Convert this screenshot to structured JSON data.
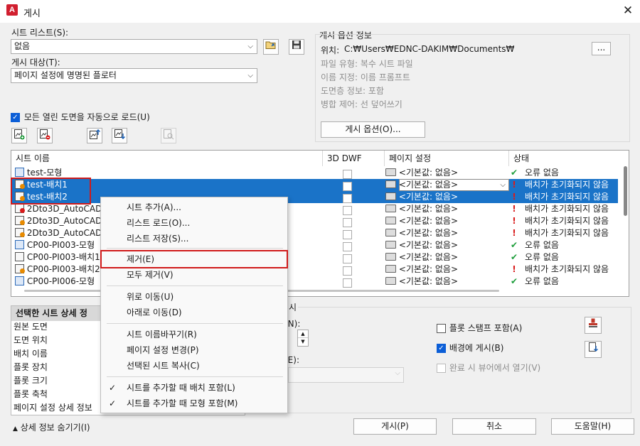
{
  "window": {
    "title": "게시",
    "app_icon_letter": "A"
  },
  "sheet_list": {
    "label": "시트 리스트(S):",
    "value": "없음"
  },
  "publish_to": {
    "label": "게시 대상(T):",
    "value": "페이지 설정에 명명된 플로터"
  },
  "publish_options": {
    "title": "게시 옵션 정보",
    "location_label": "위치:",
    "location_value": "C:₩Users₩EDNC-DAKIM₩Documents₩",
    "browse_label": "...",
    "lines": [
      "파일 유형: 복수 시트 파일",
      "이름 지정: 이름 프롬프트",
      "도면층 정보: 포함",
      "병합 제어: 선 덮어쓰기"
    ],
    "button": "게시 옵션(O)..."
  },
  "auto_load": {
    "label": "모든 열린 도면을 자동으로 로드(U)",
    "checked": true
  },
  "list": {
    "headers": [
      "시트 이름",
      "3D DWF",
      "페이지 설정",
      "상태"
    ],
    "rows": [
      {
        "name": "test-모형",
        "type": "model",
        "page": "<기본값: 없음>",
        "status": "오류 없음",
        "ok": true,
        "selected": false
      },
      {
        "name": "test-배치1",
        "type": "layout-q",
        "page": "<기본값: 없음>",
        "status": "배치가 초기화되지 않음",
        "ok": false,
        "selected": true
      },
      {
        "name": "test-배치2",
        "type": "layout-q",
        "page": "<기본값: 없음>",
        "status": "배치가 초기화되지 않음",
        "ok": false,
        "selected": true
      },
      {
        "name": "2Dto3D_AutoCAD-",
        "type": "layout-stop",
        "page": "<기본값: 없음>",
        "status": "배치가 초기화되지 않음",
        "ok": false,
        "selected": false
      },
      {
        "name": "2Dto3D_AutoCAD-",
        "type": "layout-q",
        "page": "<기본값: 없음>",
        "status": "배치가 초기화되지 않음",
        "ok": false,
        "selected": false
      },
      {
        "name": "2Dto3D_AutoCAD-",
        "type": "layout-q",
        "page": "<기본값: 없음>",
        "status": "배치가 초기화되지 않음",
        "ok": false,
        "selected": false
      },
      {
        "name": "CP00-PI003-모형",
        "type": "model",
        "page": "<기본값: 없음>",
        "status": "오류 없음",
        "ok": true,
        "selected": false
      },
      {
        "name": "CP00-PI003-배치1",
        "type": "layout",
        "page": "<기본값: 없음>",
        "status": "오류 없음",
        "ok": true,
        "selected": false
      },
      {
        "name": "CP00-PI003-배치2",
        "type": "layout-q",
        "page": "<기본값: 없음>",
        "status": "배치가 초기화되지 않음",
        "ok": false,
        "selected": false
      },
      {
        "name": "CP00-PI006-모형",
        "type": "model",
        "page": "<기본값: 없음>",
        "status": "오류 없음",
        "ok": true,
        "selected": false
      }
    ]
  },
  "context_menu": {
    "items": [
      {
        "label": "시트 추가(A)...",
        "check": false
      },
      {
        "label": "리스트 로드(O)...",
        "check": false
      },
      {
        "label": "리스트 저장(S)...",
        "check": false
      },
      {
        "label": "제거(E)",
        "check": false
      },
      {
        "label": "모두 제거(V)",
        "check": false
      },
      {
        "label": "위로 이동(U)",
        "check": false
      },
      {
        "label": "아래로 이동(D)",
        "check": false
      },
      {
        "label": "시트 이름바꾸기(R)",
        "check": false
      },
      {
        "label": "페이지 설정 변경(P)",
        "check": false
      },
      {
        "label": "선택된 시트 복사(C)",
        "check": false
      },
      {
        "label": "시트를 추가할 때 배치 포함(L)",
        "check": true
      },
      {
        "label": "시트를 추가할 때 모형 포함(M)",
        "check": true
      }
    ],
    "check_glyph": "✓"
  },
  "details": {
    "header": "선택한 시트 상세 정",
    "rows": [
      "원본 도면",
      "도면 위치",
      "배치 이름",
      "플롯 장치",
      "플롯 크기",
      "플롯 축척",
      "페이지 설정 상세 정보"
    ]
  },
  "right_panel": {
    "group_tail": "시",
    "copies_tail": "(N):",
    "precision_tail": "(E):",
    "plot_stamp": {
      "label": "플롯 스탬프 포함(A)",
      "checked": false
    },
    "background": {
      "label": "배경에 게시(B)",
      "checked": true
    },
    "open_viewer": {
      "label": "완료 시 뷰어에서 열기(V)",
      "checked": false
    }
  },
  "footer": {
    "hide_details": "상세 정보 숨기기(I)",
    "publish": "게시(P)",
    "cancel": "취소",
    "help": "도움말(H)"
  }
}
